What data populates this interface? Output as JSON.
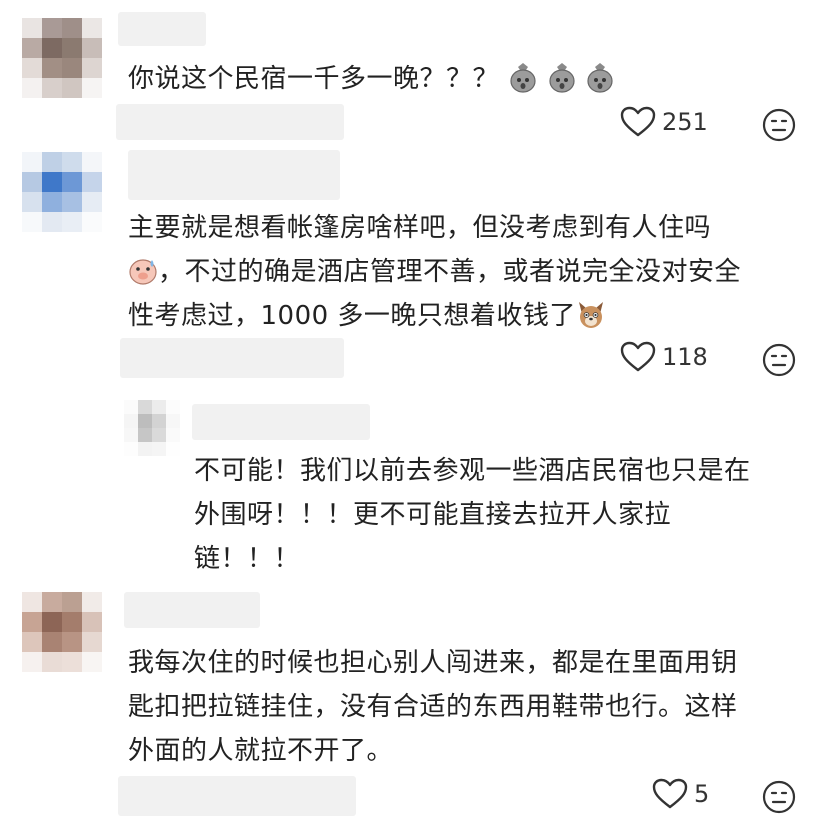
{
  "comments": [
    {
      "text_lines": [
        "你说这个民宿一千多一晚？？？"
      ],
      "emoji_icons": [
        "money-bag-icon",
        "money-bag-icon",
        "money-bag-icon"
      ],
      "like_count": "251"
    },
    {
      "text_lines": [
        "主要就是想看帐篷房啥样吧，但没考虑到有人住吗",
        "，不过的确是酒店管理不善，或者说完全没对安全",
        "性考虑过，1000 多一晚只想着收钱了"
      ],
      "emoji_icons": [
        "sweating-pig-icon",
        "dog-face-icon"
      ],
      "like_count": "118"
    },
    {
      "reply": true,
      "text_lines": [
        "不可能！我们以前去参观一些酒店民宿也只是在",
        "外围呀！！！更不可能直接去拉开人家拉",
        "链！！！"
      ]
    },
    {
      "text_lines": [
        "我每次住的时候也担心别人闯进来，都是在里面用钥",
        "匙扣把拉链挂住，没有合适的东西用鞋带也行。这样",
        "外面的人就拉不开了。"
      ],
      "like_count": "5"
    }
  ],
  "icons": {
    "like": "heart-outline-icon",
    "dislike": "dislike-face-icon"
  },
  "colors": {
    "text": "#222222",
    "count": "#333333",
    "icon_stroke": "#333333",
    "placeholder_bar": "#f1f1f1"
  }
}
